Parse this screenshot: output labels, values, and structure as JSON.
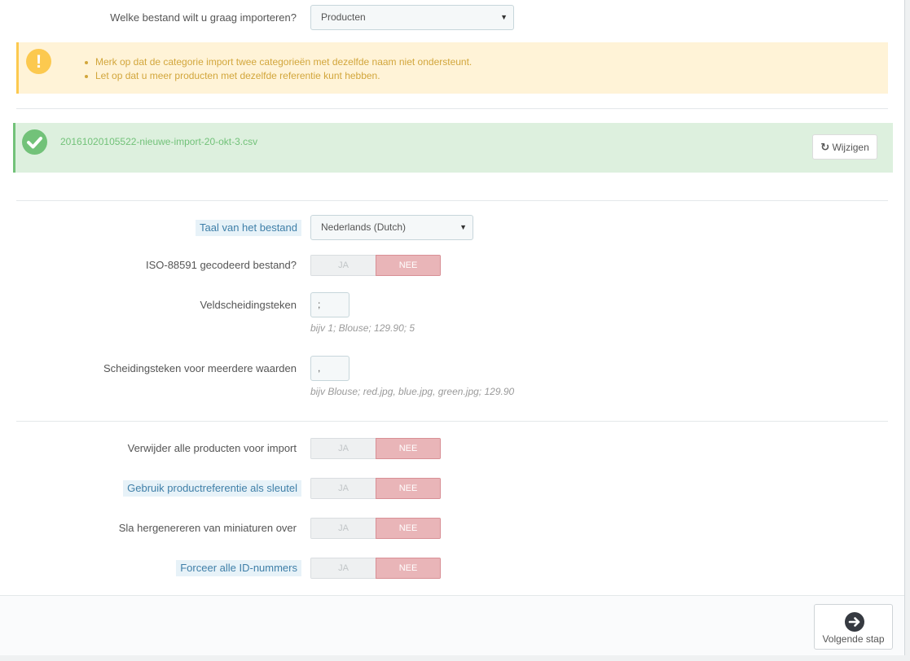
{
  "file_type": {
    "label": "Welke bestand wilt u graag importeren?",
    "value": "Producten"
  },
  "warning": {
    "items": [
      "Merk op dat de categorie import twee categorieën met dezelfde naam niet ondersteunt.",
      "Let op dat u meer producten met dezelfde referentie kunt hebben."
    ]
  },
  "uploaded_file": {
    "filename": "20161020105522-nieuwe-import-20-okt-3.csv",
    "change_label": "Wijzigen"
  },
  "language": {
    "label": "Taal van het bestand",
    "value": "Nederlands (Dutch)"
  },
  "iso": {
    "label": "ISO-88591 gecodeerd bestand?",
    "yes": "JA",
    "no": "NEE"
  },
  "separator": {
    "label": "Veldscheidingsteken",
    "value": ";",
    "help": "bijv 1; Blouse; 129.90; 5"
  },
  "multi_separator": {
    "label": "Scheidingsteken voor meerdere waarden",
    "value": ",",
    "help": "bijv Blouse; red.jpg, blue.jpg, green.jpg; 129.90"
  },
  "truncate": {
    "label": "Verwijder alle producten voor import",
    "yes": "JA",
    "no": "NEE"
  },
  "match_ref": {
    "label": "Gebruik productreferentie als sleutel",
    "yes": "JA",
    "no": "NEE"
  },
  "skip_thumbs": {
    "label": "Sla hergenereren van miniaturen over",
    "yes": "JA",
    "no": "NEE"
  },
  "force_ids": {
    "label": "Forceer alle ID-nummers",
    "yes": "JA",
    "no": "NEE"
  },
  "footer": {
    "next_label": "Volgende stap"
  }
}
